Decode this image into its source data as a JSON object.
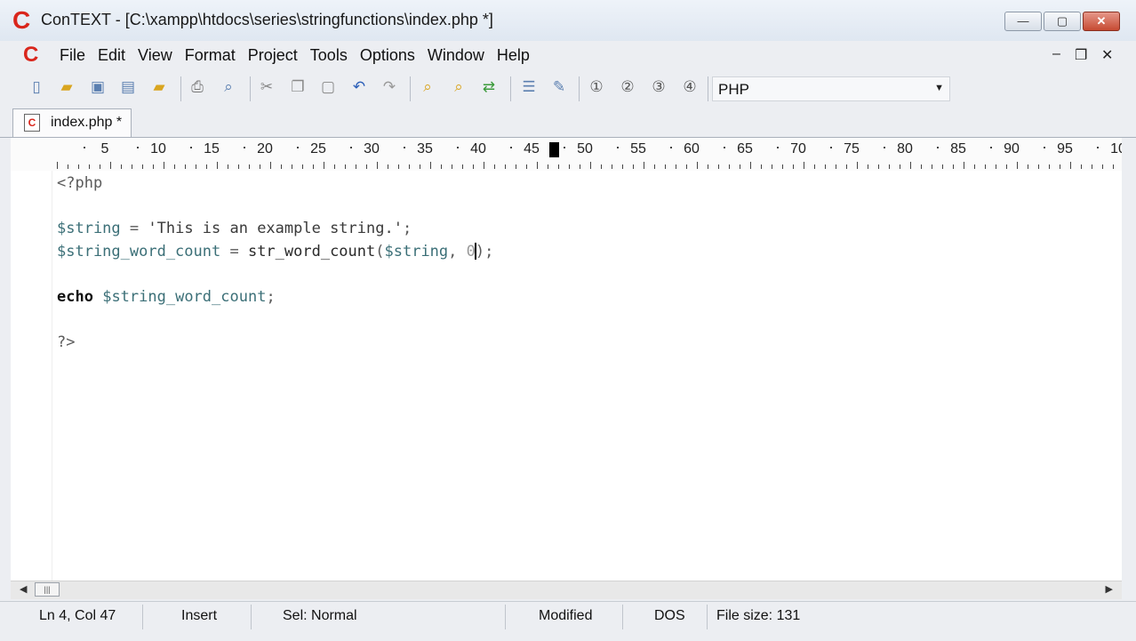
{
  "window": {
    "title": "ConTEXT - [C:\\xampp\\htdocs\\series\\stringfunctions\\index.php *]",
    "controls": {
      "minimize": "—",
      "maximize": "▢",
      "close": "✕"
    }
  },
  "menubar": {
    "items": [
      "File",
      "Edit",
      "View",
      "Format",
      "Project",
      "Tools",
      "Options",
      "Window",
      "Help"
    ],
    "mdi_controls": {
      "minimize": "‒",
      "restore": "❐",
      "close": "✕"
    }
  },
  "toolbar": {
    "language": "PHP",
    "icons": [
      "new-file-icon",
      "open-folder-icon",
      "save-icon",
      "save-all-icon",
      "open-project-icon",
      "print-icon",
      "print-preview-icon",
      "cut-icon",
      "copy-icon",
      "paste-icon",
      "undo-icon",
      "redo-icon",
      "find-icon",
      "find-next-icon",
      "replace-icon",
      "indent-icon",
      "tools-icon",
      "user-exec-1-icon",
      "user-exec-2-icon",
      "user-exec-3-icon",
      "user-exec-4-icon"
    ]
  },
  "tabs": [
    {
      "label": "index.php *",
      "active": true
    }
  ],
  "ruler": {
    "labels": [
      "5",
      "10",
      "15",
      "20",
      "25",
      "30",
      "35",
      "40",
      "45",
      "50",
      "55",
      "60",
      "65",
      "70",
      "75",
      "80",
      "85",
      "90",
      "95",
      "10"
    ]
  },
  "editor": {
    "lines": [
      {
        "segments": [
          {
            "t": "<?php",
            "c": "tag"
          }
        ]
      },
      {
        "segments": []
      },
      {
        "segments": [
          {
            "t": "$string",
            "c": "var"
          },
          {
            "t": " = ",
            "c": "op"
          },
          {
            "t": "'This is an example string.'",
            "c": "str"
          },
          {
            "t": ";",
            "c": "op"
          }
        ]
      },
      {
        "segments": [
          {
            "t": "$string_word_count",
            "c": "var"
          },
          {
            "t": " = ",
            "c": "op"
          },
          {
            "t": "str_word_count",
            "c": "fn"
          },
          {
            "t": "(",
            "c": "op"
          },
          {
            "t": "$string",
            "c": "var"
          },
          {
            "t": ", ",
            "c": "op"
          },
          {
            "t": "0",
            "c": "num"
          },
          {
            "t": "|",
            "c": "caret"
          },
          {
            "t": ")",
            "c": "op"
          },
          {
            "t": ";",
            "c": "op"
          }
        ]
      },
      {
        "segments": []
      },
      {
        "segments": [
          {
            "t": "echo",
            "c": "kw"
          },
          {
            "t": " ",
            "c": "op"
          },
          {
            "t": "$string_word_count",
            "c": "var"
          },
          {
            "t": ";",
            "c": "op"
          }
        ]
      },
      {
        "segments": []
      },
      {
        "segments": [
          {
            "t": "?>",
            "c": "tag"
          }
        ]
      }
    ]
  },
  "scrollbar": {
    "left_arrow": "◀",
    "right_arrow": "▶",
    "thumb_grip": "|||"
  },
  "statusbar": {
    "position": "Ln 4, Col 47",
    "mode": "Insert",
    "selection": "Sel: Normal",
    "modified": "Modified",
    "format": "DOS",
    "file_size": "File size: 131"
  }
}
